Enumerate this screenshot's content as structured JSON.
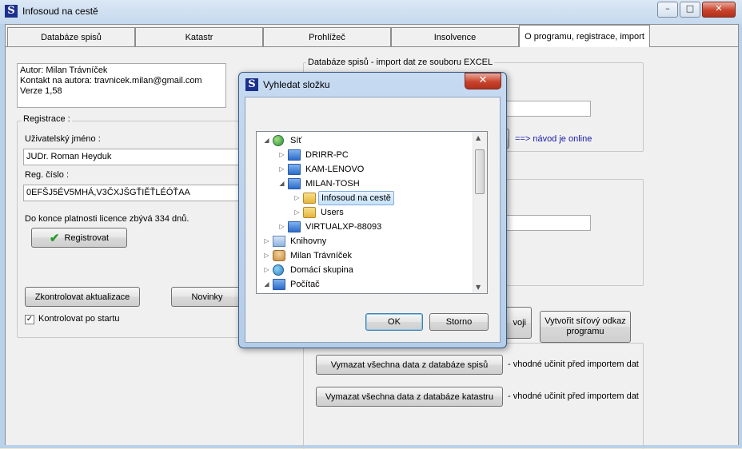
{
  "window": {
    "title": "Infosoud na cestě",
    "caption_buttons": [
      "minimize-icon",
      "maximize-icon",
      "close-icon"
    ]
  },
  "tabs": [
    {
      "label": "Databáze spisů"
    },
    {
      "label": "Katastr"
    },
    {
      "label": "Prohlížeč"
    },
    {
      "label": "Insolvence"
    },
    {
      "label": "O programu, registrace, import"
    }
  ],
  "about": {
    "author": "Autor: Milan Trávníček",
    "contact": "Kontakt na autora: travnicek.milan@gmail.com",
    "version": "Verze 1,58"
  },
  "registration": {
    "group_title": "Registrace :",
    "username_label": "Uživatelský jméno :",
    "username_value": "JUDr. Roman Heyduk",
    "regnum_label": "Reg. číslo :",
    "regnum_value": "0EFŠJ5ÉV5MHÁ,V3ČXJŠGŤIĚŤLÉÓŤAA",
    "license_text": "Do konce platnosti licence zbývá 334 dnů.",
    "register_button": "Registrovat"
  },
  "updates": {
    "check_button": "Zkontrolovat aktualizace",
    "news_button": "Novinky",
    "check_on_start_label": "Kontrolovat po startu",
    "check_on_start_checked": true
  },
  "import": {
    "group_title": "Databáze spisů - import dat ze souboru EXCEL",
    "guide_link": "==> návod je online",
    "share_button_partial": "voji",
    "network_link_button": "Vytvořit síťový odkaz programu",
    "delete_spisy_button": "Vymazat všechna data z databáze spisů",
    "delete_spisy_note": "- vhodné učinit před importem dat",
    "delete_katastr_button": "Vymazat všechna data z databáze katastru",
    "delete_katastr_note": "- vhodné učinit před importem dat"
  },
  "dialog": {
    "title": "Vyhledat složku",
    "ok_button": "OK",
    "cancel_button": "Storno",
    "tree": [
      {
        "label": "Síť",
        "icon": "network-icon",
        "expander": "expanded"
      },
      {
        "label": "DRIRR-PC",
        "icon": "computer-icon",
        "expander": "collapsed"
      },
      {
        "label": "KAM-LENOVO",
        "icon": "computer-icon",
        "expander": "collapsed"
      },
      {
        "label": "MILAN-TOSH",
        "icon": "computer-icon",
        "expander": "expanded"
      },
      {
        "label": "Infosoud na cestě",
        "icon": "shared-folder-icon",
        "expander": "collapsed",
        "selected": true
      },
      {
        "label": "Users",
        "icon": "shared-folder-icon",
        "expander": "collapsed"
      },
      {
        "label": "VIRTUALXP-88093",
        "icon": "computer-icon",
        "expander": "collapsed"
      },
      {
        "label": "Knihovny",
        "icon": "libraries-icon",
        "expander": "collapsed"
      },
      {
        "label": "Milan Trávníček",
        "icon": "user-folder-icon",
        "expander": "collapsed"
      },
      {
        "label": "Domácí skupina",
        "icon": "homegroup-icon",
        "expander": "collapsed"
      },
      {
        "label": "Počítač",
        "icon": "computer-icon",
        "expander": "expanded"
      }
    ]
  }
}
